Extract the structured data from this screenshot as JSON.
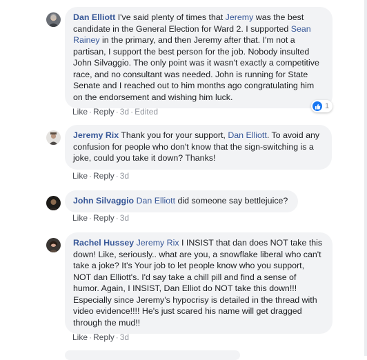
{
  "comments": [
    {
      "author": "Dan Elliott",
      "segments": [
        {
          "t": "I've said plenty of times that ",
          "m": false
        },
        {
          "t": "Jeremy",
          "m": true
        },
        {
          "t": " was the best candidate in the General Election for Ward 2. I supported ",
          "m": false
        },
        {
          "t": "Sean Rainey",
          "m": true
        },
        {
          "t": " in the primary, and then Jeremy after that. I'm not a partisan, I support the best person for the job. Nobody insulted John Silvaggio. The only point was it wasn't exactly a competitive race, and no consultant was needed. John is running for State Senate and I reached out to him months ago congratulating him on the endorsement and wishing him luck.",
          "m": false
        }
      ],
      "like": "Like",
      "reply": "Reply",
      "time": "3d",
      "edited": "Edited",
      "reaction_count": "1"
    },
    {
      "author": "Jeremy Rix",
      "segments": [
        {
          "t": "Thank you for your support, ",
          "m": false
        },
        {
          "t": "Dan Elliott",
          "m": true
        },
        {
          "t": ". To avoid any confusion for people who don't know that the sign-switching is a joke, could you take it down? Thanks!",
          "m": false
        }
      ],
      "like": "Like",
      "reply": "Reply",
      "time": "3d"
    },
    {
      "author": "John Silvaggio",
      "segments": [
        {
          "t": "Dan Elliott",
          "m": true
        },
        {
          "t": " did someone say bettlejuice?",
          "m": false
        }
      ],
      "like": "Like",
      "reply": "Reply",
      "time": "3d"
    },
    {
      "author": "Rachel Hussey",
      "segments": [
        {
          "t": "Jeremy Rix",
          "m": true
        },
        {
          "t": " I INSIST that dan does NOT take this down! Like, seriously.. what are you, a snowflake liberal who can't take a joke? It's Your job to let people know who you support, NOT dan Elliott's. I'd say take a chill pill and find a sense of humor. Again, I INSIST, Dan Elliot do NOT take this down!!! Especially since Jeremy's hypocrisy is detailed in the thread with video evidence!!!! He's just scared his name will get dragged through the mud!!",
          "m": false
        }
      ],
      "like": "Like",
      "reply": "Reply",
      "time": "3d"
    }
  ],
  "colors": {
    "link": "#385898",
    "bubble": "#f2f3f5",
    "meta": "#90949c",
    "like_blue": "#1877f2"
  },
  "icons": {
    "reaction": "thumbs-up-icon",
    "avatar": "profile-photo"
  }
}
